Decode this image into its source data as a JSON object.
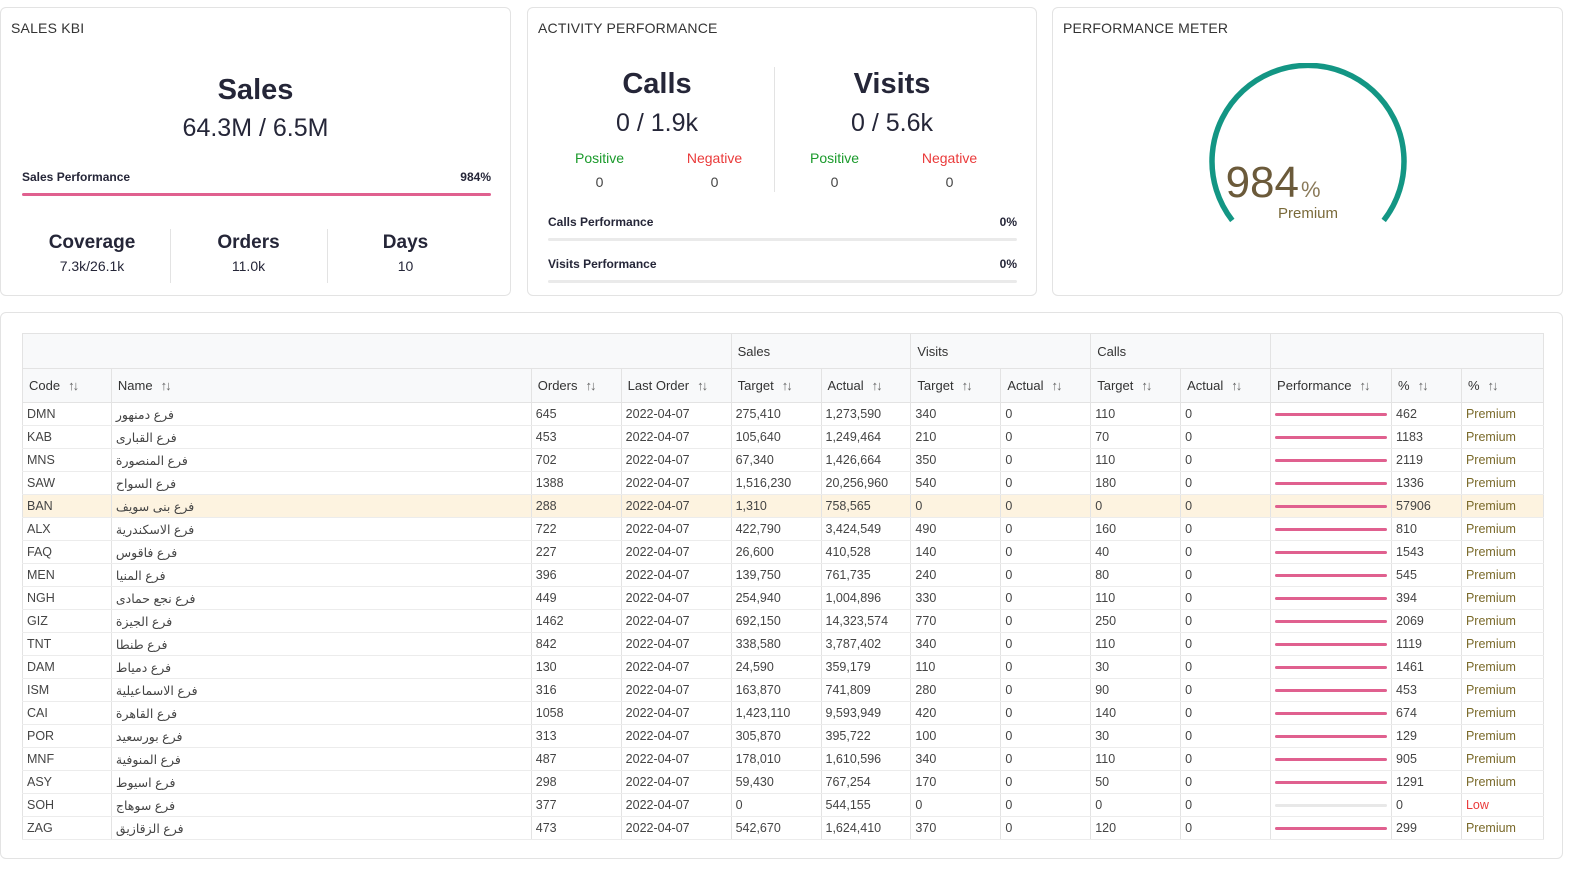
{
  "sales_kbi": {
    "title": "SALES KBI",
    "heading": "Sales",
    "value": "64.3M / 6.5M",
    "performance_label": "Sales Performance",
    "performance_value": "984%",
    "performance_fraction": 1.0,
    "coverage_label": "Coverage",
    "coverage_value": "7.3k/26.1k",
    "orders_label": "Orders",
    "orders_value": "11.0k",
    "days_label": "Days",
    "days_value": "10"
  },
  "activity": {
    "title": "ACTIVITY PERFORMANCE",
    "calls": {
      "heading": "Calls",
      "value": "0 / 1.9k",
      "positive_label": "Positive",
      "positive_value": "0",
      "negative_label": "Negative",
      "negative_value": "0"
    },
    "visits": {
      "heading": "Visits",
      "value": "0 / 5.6k",
      "positive_label": "Positive",
      "positive_value": "0",
      "negative_label": "Negative",
      "negative_value": "0"
    },
    "calls_perf_label": "Calls Performance",
    "calls_perf_value": "0%",
    "visits_perf_label": "Visits Performance",
    "visits_perf_value": "0%"
  },
  "meter": {
    "title": "PERFORMANCE METER",
    "value": "984",
    "unit": "%",
    "status": "Premium",
    "color": "#139684"
  },
  "table": {
    "group_headers": {
      "sales": "Sales",
      "visits": "Visits",
      "calls": "Calls"
    },
    "columns": [
      "Code",
      "Name",
      "Orders",
      "Last Order",
      "Target",
      "Actual",
      "Target",
      "Actual",
      "Target",
      "Actual",
      "Performance",
      "%",
      "%"
    ],
    "rows": [
      {
        "code": "DMN",
        "name": "فرع دمنهور",
        "orders": "645",
        "last": "2022-04-07",
        "s_t": "275,410",
        "s_a": "1,273,590",
        "v_t": "340",
        "v_a": "0",
        "c_t": "110",
        "c_a": "0",
        "perf": 1.0,
        "pct": "462",
        "status": "Premium"
      },
      {
        "code": "KAB",
        "name": "فرع القبارى",
        "orders": "453",
        "last": "2022-04-07",
        "s_t": "105,640",
        "s_a": "1,249,464",
        "v_t": "210",
        "v_a": "0",
        "c_t": "70",
        "c_a": "0",
        "perf": 1.0,
        "pct": "1183",
        "status": "Premium"
      },
      {
        "code": "MNS",
        "name": "فرع المنصورة",
        "orders": "702",
        "last": "2022-04-07",
        "s_t": "67,340",
        "s_a": "1,426,664",
        "v_t": "350",
        "v_a": "0",
        "c_t": "110",
        "c_a": "0",
        "perf": 1.0,
        "pct": "2119",
        "status": "Premium"
      },
      {
        "code": "SAW",
        "name": "فرع السواح",
        "orders": "1388",
        "last": "2022-04-07",
        "s_t": "1,516,230",
        "s_a": "20,256,960",
        "v_t": "540",
        "v_a": "0",
        "c_t": "180",
        "c_a": "0",
        "perf": 1.0,
        "pct": "1336",
        "status": "Premium"
      },
      {
        "code": "BAN",
        "name": "فرع بنى سويف",
        "orders": "288",
        "last": "2022-04-07",
        "s_t": "1,310",
        "s_a": "758,565",
        "v_t": "0",
        "v_a": "0",
        "c_t": "0",
        "c_a": "0",
        "perf": 1.0,
        "pct": "57906",
        "status": "Premium",
        "highlight": true
      },
      {
        "code": "ALX",
        "name": "فرع الاسكندرية",
        "orders": "722",
        "last": "2022-04-07",
        "s_t": "422,790",
        "s_a": "3,424,549",
        "v_t": "490",
        "v_a": "0",
        "c_t": "160",
        "c_a": "0",
        "perf": 1.0,
        "pct": "810",
        "status": "Premium"
      },
      {
        "code": "FAQ",
        "name": "فرع فاقوس",
        "orders": "227",
        "last": "2022-04-07",
        "s_t": "26,600",
        "s_a": "410,528",
        "v_t": "140",
        "v_a": "0",
        "c_t": "40",
        "c_a": "0",
        "perf": 1.0,
        "pct": "1543",
        "status": "Premium"
      },
      {
        "code": "MEN",
        "name": "فرع المنيا",
        "orders": "396",
        "last": "2022-04-07",
        "s_t": "139,750",
        "s_a": "761,735",
        "v_t": "240",
        "v_a": "0",
        "c_t": "80",
        "c_a": "0",
        "perf": 1.0,
        "pct": "545",
        "status": "Premium"
      },
      {
        "code": "NGH",
        "name": "فرع نجع حمادى",
        "orders": "449",
        "last": "2022-04-07",
        "s_t": "254,940",
        "s_a": "1,004,896",
        "v_t": "330",
        "v_a": "0",
        "c_t": "110",
        "c_a": "0",
        "perf": 1.0,
        "pct": "394",
        "status": "Premium"
      },
      {
        "code": "GIZ",
        "name": "فرع الجيزة",
        "orders": "1462",
        "last": "2022-04-07",
        "s_t": "692,150",
        "s_a": "14,323,574",
        "v_t": "770",
        "v_a": "0",
        "c_t": "250",
        "c_a": "0",
        "perf": 1.0,
        "pct": "2069",
        "status": "Premium"
      },
      {
        "code": "TNT",
        "name": "فرع طنطا",
        "orders": "842",
        "last": "2022-04-07",
        "s_t": "338,580",
        "s_a": "3,787,402",
        "v_t": "340",
        "v_a": "0",
        "c_t": "110",
        "c_a": "0",
        "perf": 1.0,
        "pct": "1119",
        "status": "Premium"
      },
      {
        "code": "DAM",
        "name": "فرع دمياط",
        "orders": "130",
        "last": "2022-04-07",
        "s_t": "24,590",
        "s_a": "359,179",
        "v_t": "110",
        "v_a": "0",
        "c_t": "30",
        "c_a": "0",
        "perf": 1.0,
        "pct": "1461",
        "status": "Premium"
      },
      {
        "code": "ISM",
        "name": "فرع الاسماعيلية",
        "orders": "316",
        "last": "2022-04-07",
        "s_t": "163,870",
        "s_a": "741,809",
        "v_t": "280",
        "v_a": "0",
        "c_t": "90",
        "c_a": "0",
        "perf": 1.0,
        "pct": "453",
        "status": "Premium"
      },
      {
        "code": "CAI",
        "name": "فرع القاهرة",
        "orders": "1058",
        "last": "2022-04-07",
        "s_t": "1,423,110",
        "s_a": "9,593,949",
        "v_t": "420",
        "v_a": "0",
        "c_t": "140",
        "c_a": "0",
        "perf": 1.0,
        "pct": "674",
        "status": "Premium"
      },
      {
        "code": "POR",
        "name": "فرع بورسعيد",
        "orders": "313",
        "last": "2022-04-07",
        "s_t": "305,870",
        "s_a": "395,722",
        "v_t": "100",
        "v_a": "0",
        "c_t": "30",
        "c_a": "0",
        "perf": 1.0,
        "pct": "129",
        "status": "Premium"
      },
      {
        "code": "MNF",
        "name": "فرع المنوفية",
        "orders": "487",
        "last": "2022-04-07",
        "s_t": "178,010",
        "s_a": "1,610,596",
        "v_t": "340",
        "v_a": "0",
        "c_t": "110",
        "c_a": "0",
        "perf": 1.0,
        "pct": "905",
        "status": "Premium"
      },
      {
        "code": "ASY",
        "name": "فرع اسيوط",
        "orders": "298",
        "last": "2022-04-07",
        "s_t": "59,430",
        "s_a": "767,254",
        "v_t": "170",
        "v_a": "0",
        "c_t": "50",
        "c_a": "0",
        "perf": 1.0,
        "pct": "1291",
        "status": "Premium"
      },
      {
        "code": "SOH",
        "name": "فرع سوهاج",
        "orders": "377",
        "last": "2022-04-07",
        "s_t": "0",
        "s_a": "544,155",
        "v_t": "0",
        "v_a": "0",
        "c_t": "0",
        "c_a": "0",
        "perf": 0.0,
        "pct": "0",
        "status": "Low"
      },
      {
        "code": "ZAG",
        "name": "فرع الزقازيق",
        "orders": "473",
        "last": "2022-04-07",
        "s_t": "542,670",
        "s_a": "1,624,410",
        "v_t": "370",
        "v_a": "0",
        "c_t": "120",
        "c_a": "0",
        "perf": 1.0,
        "pct": "299",
        "status": "Premium"
      }
    ]
  }
}
